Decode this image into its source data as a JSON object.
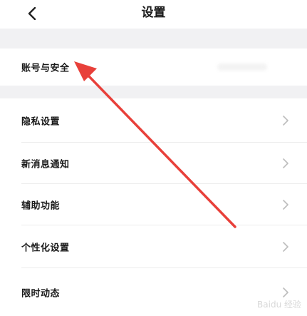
{
  "header": {
    "title": "设置"
  },
  "menu": {
    "items": [
      {
        "label": "账号与安全"
      },
      {
        "label": "隐私设置"
      },
      {
        "label": "新消息通知"
      },
      {
        "label": "辅助功能"
      },
      {
        "label": "个性化设置"
      },
      {
        "label": "限时动态"
      }
    ]
  },
  "annotation": {
    "arrow_color": "#e8403a"
  },
  "watermark": {
    "text": "Baidu 经验"
  }
}
